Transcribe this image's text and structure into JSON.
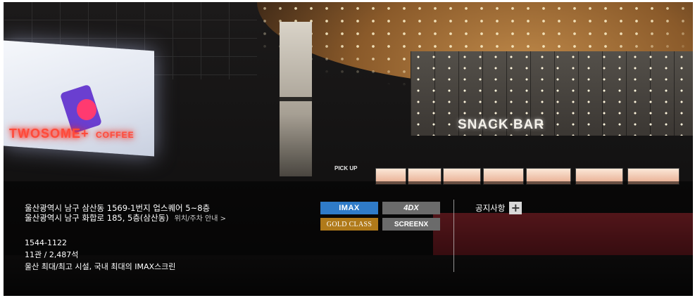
{
  "background": {
    "neon_sign": {
      "brand": "TWOSOME",
      "plus": "+",
      "coffee": "COFFEE"
    },
    "snack_bar_sign": "SNACK BAR",
    "pickup_sign": "PICK UP"
  },
  "theater": {
    "address_lot": "울산광역시 남구 삼산동 1569-1번지 업스퀘어 5~8층",
    "address_road": "울산광역시 남구 화합로 185, 5층(삼산동)",
    "map_link": "위치/주차 안내 >",
    "phone": "1544-1122",
    "capacity": "11관 / 2,487석",
    "description": "울산 최대/최고 시설, 국내 최대의 IMAX스크린"
  },
  "formats": [
    {
      "label": "IMAX",
      "color": "#2f7bc8"
    },
    {
      "label": "4DX",
      "color": "#6b6b6b"
    },
    {
      "label": "GOLD CLASS",
      "color": "#b07a1a"
    },
    {
      "label": "SCREENX",
      "color": "#6b6b6b"
    }
  ],
  "notice": {
    "label": "공지사항",
    "icon": "plus-icon",
    "glyph": "+"
  }
}
